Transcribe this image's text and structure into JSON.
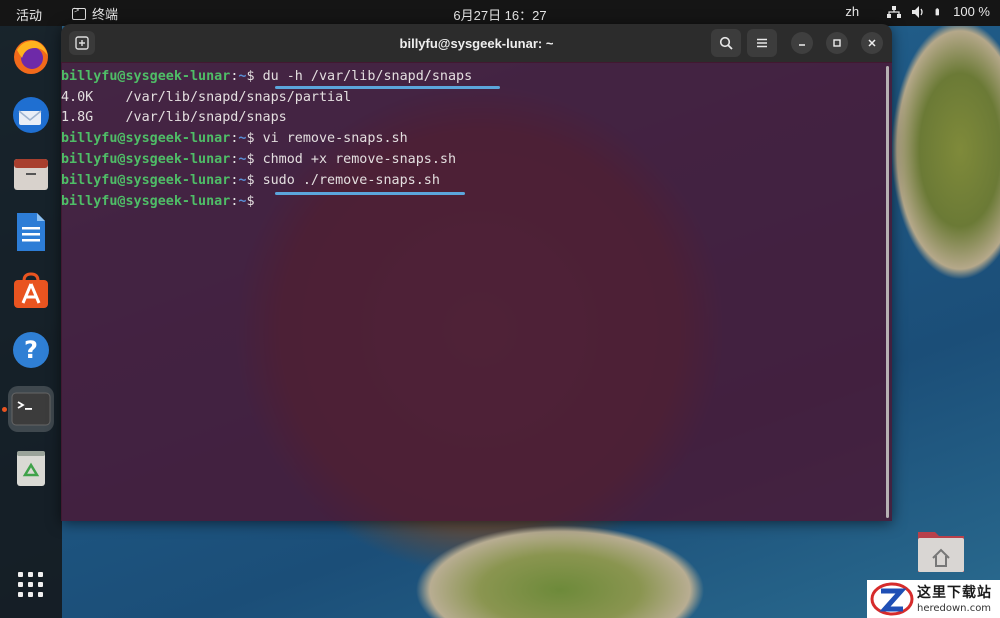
{
  "topbar": {
    "activities": "活动",
    "app_name": "终端",
    "clock": "6月27日  16：27",
    "input_method": "zh",
    "battery": "100 %"
  },
  "dock": {
    "items": [
      {
        "name": "firefox-icon"
      },
      {
        "name": "thunderbird-icon"
      },
      {
        "name": "files-icon"
      },
      {
        "name": "writer-icon"
      },
      {
        "name": "app-center-icon"
      },
      {
        "name": "help-icon"
      },
      {
        "name": "terminal-icon",
        "active": true
      },
      {
        "name": "trash-icon"
      }
    ],
    "show_apps": "show-apps-icon"
  },
  "terminal": {
    "title": "billyfu@sysgeek-lunar: ~",
    "prompt_user": "billyfu@sysgeek-lunar",
    "prompt_colon": ":",
    "prompt_path": "~",
    "prompt_symbol": "$",
    "lines": [
      {
        "type": "command",
        "text": "du -h /var/lib/snapd/snaps",
        "highlighted": true
      },
      {
        "type": "output",
        "text": "4.0K    /var/lib/snapd/snaps/partial"
      },
      {
        "type": "output",
        "text": "1.8G    /var/lib/snapd/snaps"
      },
      {
        "type": "command",
        "text": "vi remove-snaps.sh"
      },
      {
        "type": "command",
        "text": "chmod +x remove-snaps.sh"
      },
      {
        "type": "command",
        "text": "sudo ./remove-snaps.sh",
        "highlighted": true
      },
      {
        "type": "command",
        "text": ""
      }
    ]
  },
  "watermark": {
    "cn": "这里下载站",
    "url": "heredown.com"
  },
  "colors": {
    "prompt_user": "#4fbd67",
    "prompt_path": "#5a8fd6",
    "highlight": "#5ba6dc",
    "terminal_bg": "#4a1834"
  }
}
